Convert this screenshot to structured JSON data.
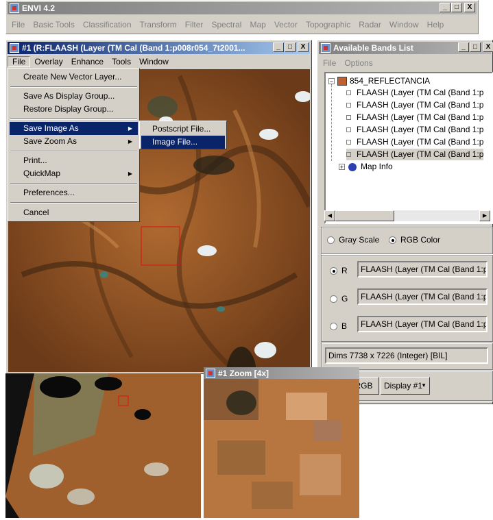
{
  "app": {
    "title": "ENVI 4.2",
    "menu": [
      "File",
      "Basic Tools",
      "Classification",
      "Transform",
      "Filter",
      "Spectral",
      "Map",
      "Vector",
      "Topographic",
      "Radar",
      "Window",
      "Help"
    ]
  },
  "display": {
    "title": "#1 (R:FLAASH (Layer (TM Cal (Band 1:p008r054_7t2001...",
    "menu": [
      "File",
      "Overlay",
      "Enhance",
      "Tools",
      "Window"
    ]
  },
  "file_menu": {
    "items": [
      {
        "label": "Create New Vector Layer..."
      },
      {
        "label": "Save As Display Group..."
      },
      {
        "label": "Restore Display Group..."
      },
      {
        "label": "Save Image As",
        "submenu": true,
        "selected": true
      },
      {
        "label": "Save Zoom As",
        "submenu": true
      },
      {
        "label": "Print..."
      },
      {
        "label": "QuickMap",
        "submenu": true
      },
      {
        "label": "Preferences..."
      },
      {
        "label": "Cancel"
      }
    ],
    "submenu_items": [
      "Postscript File...",
      "Image File..."
    ],
    "submenu_selected": "Image File..."
  },
  "bands_list": {
    "title": "Available Bands List",
    "menu": [
      "File",
      "Options"
    ],
    "root": "854_REFLECTANCIA",
    "bands": [
      "FLAASH (Layer (TM Cal (Band 1:p",
      "FLAASH (Layer (TM Cal (Band 1:p",
      "FLAASH (Layer (TM Cal (Band 1:p",
      "FLAASH (Layer (TM Cal (Band 1:p",
      "FLAASH (Layer (TM Cal (Band 1:p",
      "FLAASH (Layer (TM Cal (Band 1:p"
    ],
    "map_info": "Map Info",
    "mode": {
      "gray": "Gray Scale",
      "rgb": "RGB Color",
      "selected": "rgb"
    },
    "channels": [
      {
        "letter": "R",
        "value": "FLAASH (Layer (TM Cal (Band 1:p",
        "selected": true
      },
      {
        "letter": "G",
        "value": "FLAASH (Layer (TM Cal (Band 1:p",
        "selected": false
      },
      {
        "letter": "B",
        "value": "FLAASH (Layer (TM Cal (Band 1:p",
        "selected": false
      }
    ],
    "dims": "Dims 7738 x 7226 (Integer) [BIL]",
    "load_button": "Load RGB",
    "display_select": "Display #1"
  },
  "zoom_window": {
    "title": "#1 Zoom [4x]"
  },
  "window_buttons": {
    "min": "_",
    "max": "□",
    "close": "X"
  }
}
